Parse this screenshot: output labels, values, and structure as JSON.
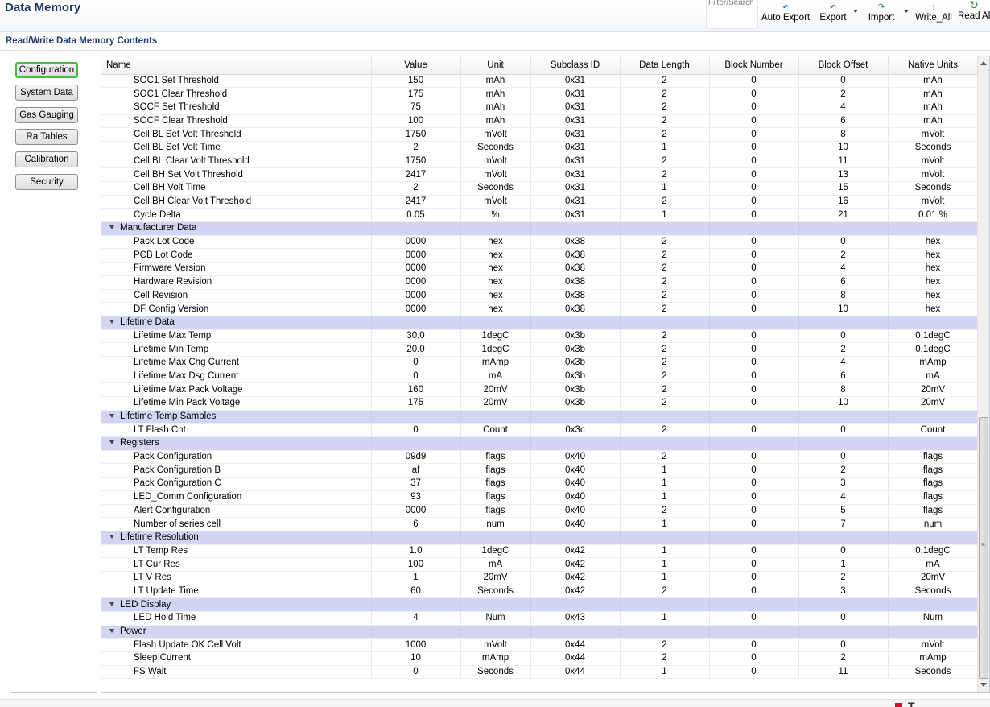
{
  "app": {
    "title": "Data Memory"
  },
  "toolbar": {
    "filter_label": "Filter/Search",
    "buttons": [
      {
        "label": "Auto Export",
        "icon": "auto-export-icon"
      },
      {
        "label": "Export",
        "icon": "export-icon"
      },
      {
        "label": "Import",
        "icon": "import-icon"
      },
      {
        "label": "Write_All",
        "icon": "write-all-icon"
      },
      {
        "label": "Read All",
        "icon": "refresh-icon"
      }
    ]
  },
  "section": {
    "title": "Read/Write Data Memory Contents"
  },
  "nav": {
    "items": [
      {
        "label": "Configuration",
        "active": true
      },
      {
        "label": "System Data"
      },
      {
        "label": "Gas Gauging"
      },
      {
        "label": "Ra Tables"
      },
      {
        "label": "Calibration"
      },
      {
        "label": "Security"
      }
    ]
  },
  "table": {
    "columns": [
      "Name",
      "Value",
      "Unit",
      "Subclass ID",
      "Data Length",
      "Block Number",
      "Block Offset",
      "Native Units"
    ],
    "rows": [
      {
        "type": "row",
        "cells": [
          "SOC1 Set Threshold",
          "150",
          "mAh",
          "0x31",
          "2",
          "0",
          "0",
          "mAh"
        ]
      },
      {
        "type": "row",
        "cells": [
          "SOC1 Clear Threshold",
          "175",
          "mAh",
          "0x31",
          "2",
          "0",
          "2",
          "mAh"
        ]
      },
      {
        "type": "row",
        "cells": [
          "SOCF Set Threshold",
          "75",
          "mAh",
          "0x31",
          "2",
          "0",
          "4",
          "mAh"
        ]
      },
      {
        "type": "row",
        "cells": [
          "SOCF Clear Threshold",
          "100",
          "mAh",
          "0x31",
          "2",
          "0",
          "6",
          "mAh"
        ]
      },
      {
        "type": "row",
        "cells": [
          "Cell BL Set Volt Threshold",
          "1750",
          "mVolt",
          "0x31",
          "2",
          "0",
          "8",
          "mVolt"
        ]
      },
      {
        "type": "row",
        "cells": [
          "Cell BL Set Volt Time",
          "2",
          "Seconds",
          "0x31",
          "1",
          "0",
          "10",
          "Seconds"
        ]
      },
      {
        "type": "row",
        "cells": [
          "Cell BL Clear Volt Threshold",
          "1750",
          "mVolt",
          "0x31",
          "2",
          "0",
          "11",
          "mVolt"
        ]
      },
      {
        "type": "row",
        "cells": [
          "Cell BH Set Volt Threshold",
          "2417",
          "mVolt",
          "0x31",
          "2",
          "0",
          "13",
          "mVolt"
        ]
      },
      {
        "type": "row",
        "cells": [
          "Cell BH Volt Time",
          "2",
          "Seconds",
          "0x31",
          "1",
          "0",
          "15",
          "Seconds"
        ]
      },
      {
        "type": "row",
        "cells": [
          "Cell BH  Clear Volt Threshold",
          "2417",
          "mVolt",
          "0x31",
          "2",
          "0",
          "16",
          "mVolt"
        ]
      },
      {
        "type": "row",
        "cells": [
          "Cycle Delta",
          "0.05",
          "%",
          "0x31",
          "1",
          "0",
          "21",
          "0.01 %"
        ]
      },
      {
        "type": "group",
        "label": "Manufacturer Data"
      },
      {
        "type": "row",
        "cells": [
          "Pack Lot Code",
          "0000",
          "hex",
          "0x38",
          "2",
          "0",
          "0",
          "hex"
        ]
      },
      {
        "type": "row",
        "cells": [
          "PCB Lot Code",
          "0000",
          "hex",
          "0x38",
          "2",
          "0",
          "2",
          "hex"
        ]
      },
      {
        "type": "row",
        "cells": [
          "Firmware Version",
          "0000",
          "hex",
          "0x38",
          "2",
          "0",
          "4",
          "hex"
        ]
      },
      {
        "type": "row",
        "cells": [
          "Hardware Revision",
          "0000",
          "hex",
          "0x38",
          "2",
          "0",
          "6",
          "hex"
        ]
      },
      {
        "type": "row",
        "cells": [
          "Cell Revision",
          "0000",
          "hex",
          "0x38",
          "2",
          "0",
          "8",
          "hex"
        ]
      },
      {
        "type": "row",
        "cells": [
          "DF Config Version",
          "0000",
          "hex",
          "0x38",
          "2",
          "0",
          "10",
          "hex"
        ]
      },
      {
        "type": "group",
        "label": "Lifetime Data"
      },
      {
        "type": "row",
        "cells": [
          "Lifetime Max Temp",
          "30.0",
          "1degC",
          "0x3b",
          "2",
          "0",
          "0",
          "0.1degC"
        ]
      },
      {
        "type": "row",
        "cells": [
          "Lifetime Min Temp",
          "20.0",
          "1degC",
          "0x3b",
          "2",
          "0",
          "2",
          "0.1degC"
        ]
      },
      {
        "type": "row",
        "cells": [
          "Lifetime Max Chg Current",
          "0",
          "mAmp",
          "0x3b",
          "2",
          "0",
          "4",
          "mAmp"
        ]
      },
      {
        "type": "row",
        "cells": [
          "Lifetime Max Dsg Current",
          "0",
          "mA",
          "0x3b",
          "2",
          "0",
          "6",
          "mA"
        ]
      },
      {
        "type": "row",
        "cells": [
          "Lifetime Max Pack Voltage",
          "160",
          "20mV",
          "0x3b",
          "2",
          "0",
          "8",
          "20mV"
        ]
      },
      {
        "type": "row",
        "cells": [
          "Lifetime Min Pack Voltage",
          "175",
          "20mV",
          "0x3b",
          "2",
          "0",
          "10",
          "20mV"
        ]
      },
      {
        "type": "group",
        "label": "Lifetime Temp Samples"
      },
      {
        "type": "row",
        "cells": [
          "LT Flash Cnt",
          "0",
          "Count",
          "0x3c",
          "2",
          "0",
          "0",
          "Count"
        ]
      },
      {
        "type": "group",
        "label": "Registers"
      },
      {
        "type": "row",
        "cells": [
          "Pack Configuration",
          "09d9",
          "flags",
          "0x40",
          "2",
          "0",
          "0",
          "flags"
        ]
      },
      {
        "type": "row",
        "cells": [
          "Pack Configuration B",
          "af",
          "flags",
          "0x40",
          "1",
          "0",
          "2",
          "flags"
        ]
      },
      {
        "type": "row",
        "cells": [
          "Pack Configuration C",
          "37",
          "flags",
          "0x40",
          "1",
          "0",
          "3",
          "flags"
        ]
      },
      {
        "type": "row",
        "cells": [
          "LED_Comm Configuration",
          "93",
          "flags",
          "0x40",
          "1",
          "0",
          "4",
          "flags"
        ]
      },
      {
        "type": "row",
        "cells": [
          "Alert Configuration",
          "0000",
          "flags",
          "0x40",
          "2",
          "0",
          "5",
          "flags"
        ]
      },
      {
        "type": "row",
        "cells": [
          "Number of series cell",
          "6",
          "num",
          "0x40",
          "1",
          "0",
          "7",
          "num"
        ]
      },
      {
        "type": "group",
        "label": "Lifetime Resolution"
      },
      {
        "type": "row",
        "cells": [
          "LT Temp Res",
          "1.0",
          "1degC",
          "0x42",
          "1",
          "0",
          "0",
          "0.1degC"
        ]
      },
      {
        "type": "row",
        "cells": [
          "LT Cur Res",
          "100",
          "mA",
          "0x42",
          "1",
          "0",
          "1",
          "mA"
        ]
      },
      {
        "type": "row",
        "cells": [
          "LT V Res",
          "1",
          "20mV",
          "0x42",
          "1",
          "0",
          "2",
          "20mV"
        ]
      },
      {
        "type": "row",
        "cells": [
          "LT Update Time",
          "60",
          "Seconds",
          "0x42",
          "2",
          "0",
          "3",
          "Seconds"
        ]
      },
      {
        "type": "group",
        "label": "LED Display"
      },
      {
        "type": "row",
        "cells": [
          "LED Hold Time",
          "4",
          "Num",
          "0x43",
          "1",
          "0",
          "0",
          "Num"
        ]
      },
      {
        "type": "group",
        "label": "Power"
      },
      {
        "type": "row",
        "cells": [
          "Flash Update OK Cell Volt",
          "1000",
          "mVolt",
          "0x44",
          "2",
          "0",
          "0",
          "mVolt"
        ]
      },
      {
        "type": "row",
        "cells": [
          "Sleep Current",
          "10",
          "mAmp",
          "0x44",
          "2",
          "0",
          "2",
          "mAmp"
        ]
      },
      {
        "type": "row",
        "cells": [
          "FS Wait",
          "0",
          "Seconds",
          "0x44",
          "1",
          "0",
          "11",
          "Seconds"
        ]
      }
    ]
  },
  "footer": {
    "brand_text": "T"
  }
}
